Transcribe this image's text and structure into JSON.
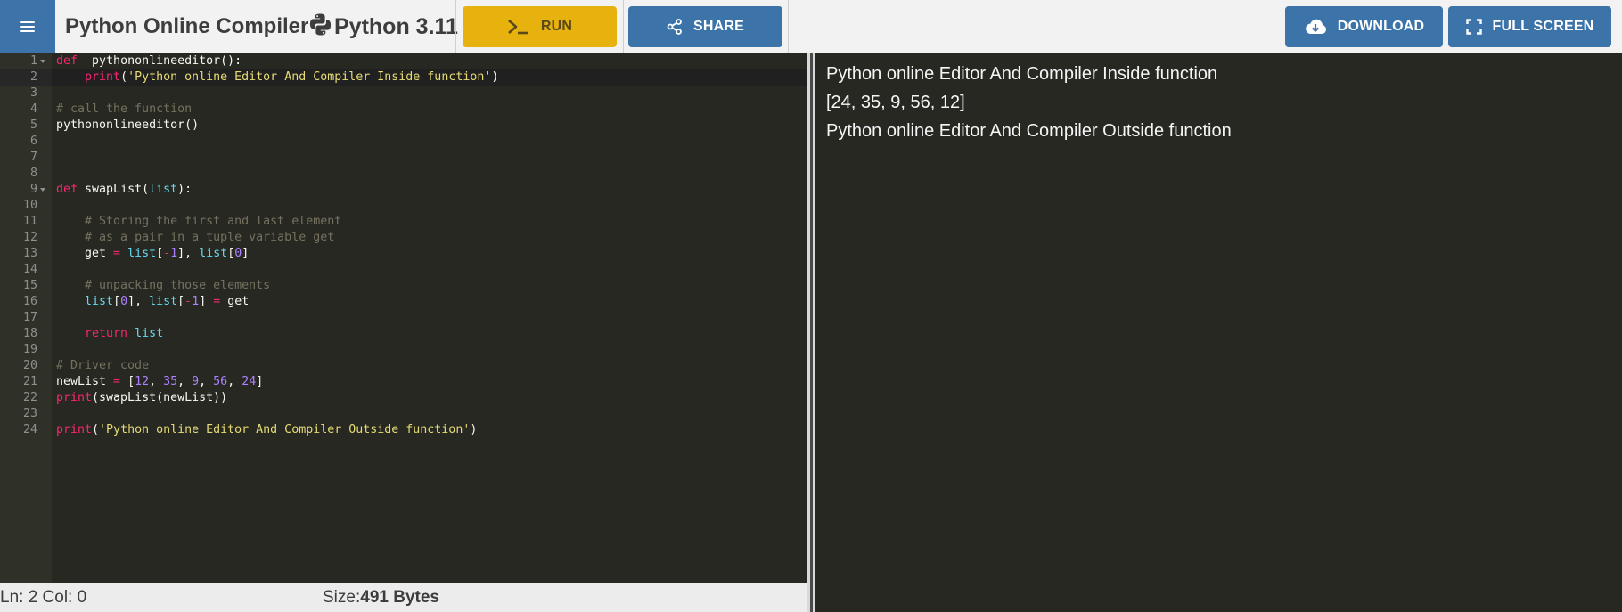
{
  "header": {
    "title": "Python Online Compiler",
    "version_label": "Python 3.11",
    "run_label": "RUN",
    "share_label": "SHARE",
    "download_label": "DOWNLOAD",
    "fullscreen_label": "FULL SCREEN"
  },
  "colors": {
    "primary_blue": "#3c73a8",
    "run_yellow": "#e7b10e",
    "editor_bg": "#272822",
    "python_blue": "#3776ab",
    "python_yellow": "#ffd43b"
  },
  "editor": {
    "active_line": 2,
    "lines": [
      {
        "n": "1",
        "fold": true,
        "t": [
          [
            "kw",
            "def"
          ],
          [
            "",
            "  pythononlineeditor():"
          ]
        ]
      },
      {
        "n": "2",
        "t": [
          [
            "",
            "    "
          ],
          [
            "kw",
            "print"
          ],
          [
            "",
            "("
          ],
          [
            "str",
            "'Python online Editor And Compiler Inside function'"
          ],
          [
            "",
            ")"
          ]
        ]
      },
      {
        "n": "3",
        "t": []
      },
      {
        "n": "4",
        "t": [
          [
            "com",
            "# call the function"
          ]
        ]
      },
      {
        "n": "5",
        "t": [
          [
            "",
            "pythononlineeditor()"
          ]
        ]
      },
      {
        "n": "6",
        "t": []
      },
      {
        "n": "7",
        "t": []
      },
      {
        "n": "8",
        "t": []
      },
      {
        "n": "9",
        "fold": true,
        "t": [
          [
            "kw",
            "def"
          ],
          [
            "",
            " swapList("
          ],
          [
            "bi",
            "list"
          ],
          [
            "",
            "):"
          ]
        ]
      },
      {
        "n": "10",
        "t": []
      },
      {
        "n": "11",
        "t": [
          [
            "",
            "    "
          ],
          [
            "com",
            "# Storing the first and last element"
          ]
        ]
      },
      {
        "n": "12",
        "t": [
          [
            "",
            "    "
          ],
          [
            "com",
            "# as a pair in a tuple variable get"
          ]
        ]
      },
      {
        "n": "13",
        "t": [
          [
            "",
            "    get "
          ],
          [
            "op",
            "="
          ],
          [
            "",
            " "
          ],
          [
            "bi",
            "list"
          ],
          [
            "",
            "["
          ],
          [
            "op",
            "-"
          ],
          [
            "num",
            "1"
          ],
          [
            "",
            "], "
          ],
          [
            "bi",
            "list"
          ],
          [
            "",
            "["
          ],
          [
            "num",
            "0"
          ],
          [
            "",
            "]"
          ]
        ]
      },
      {
        "n": "14",
        "t": []
      },
      {
        "n": "15",
        "t": [
          [
            "",
            "    "
          ],
          [
            "com",
            "# unpacking those elements"
          ]
        ]
      },
      {
        "n": "16",
        "t": [
          [
            "",
            "    "
          ],
          [
            "bi",
            "list"
          ],
          [
            "",
            "["
          ],
          [
            "num",
            "0"
          ],
          [
            "",
            "], "
          ],
          [
            "bi",
            "list"
          ],
          [
            "",
            "["
          ],
          [
            "op",
            "-"
          ],
          [
            "num",
            "1"
          ],
          [
            "",
            "] "
          ],
          [
            "op",
            "="
          ],
          [
            "",
            " get"
          ]
        ]
      },
      {
        "n": "17",
        "t": []
      },
      {
        "n": "18",
        "t": [
          [
            "",
            "    "
          ],
          [
            "kw",
            "return"
          ],
          [
            "",
            " "
          ],
          [
            "bi",
            "list"
          ]
        ]
      },
      {
        "n": "19",
        "t": []
      },
      {
        "n": "20",
        "t": [
          [
            "com",
            "# Driver code"
          ]
        ]
      },
      {
        "n": "21",
        "t": [
          [
            "",
            "newList "
          ],
          [
            "op",
            "="
          ],
          [
            "",
            " ["
          ],
          [
            "num",
            "12"
          ],
          [
            "",
            ", "
          ],
          [
            "num",
            "35"
          ],
          [
            "",
            ", "
          ],
          [
            "num",
            "9"
          ],
          [
            "",
            ", "
          ],
          [
            "num",
            "56"
          ],
          [
            "",
            ", "
          ],
          [
            "num",
            "24"
          ],
          [
            "",
            "]"
          ]
        ]
      },
      {
        "n": "22",
        "t": [
          [
            "kw",
            "print"
          ],
          [
            "",
            "(swapList(newList))"
          ]
        ]
      },
      {
        "n": "23",
        "t": []
      },
      {
        "n": "24",
        "t": [
          [
            "kw",
            "print"
          ],
          [
            "",
            "("
          ],
          [
            "str",
            "'Python online Editor And Compiler Outside function'"
          ],
          [
            "",
            ")"
          ]
        ]
      }
    ]
  },
  "status": {
    "position": "Ln: 2 Col: 0",
    "size_label": "Size:",
    "size_value": "491 Bytes"
  },
  "output": {
    "lines": [
      "Python online Editor And Compiler Inside function",
      "[24, 35, 9, 56, 12]",
      "Python online Editor And Compiler Outside function"
    ]
  }
}
